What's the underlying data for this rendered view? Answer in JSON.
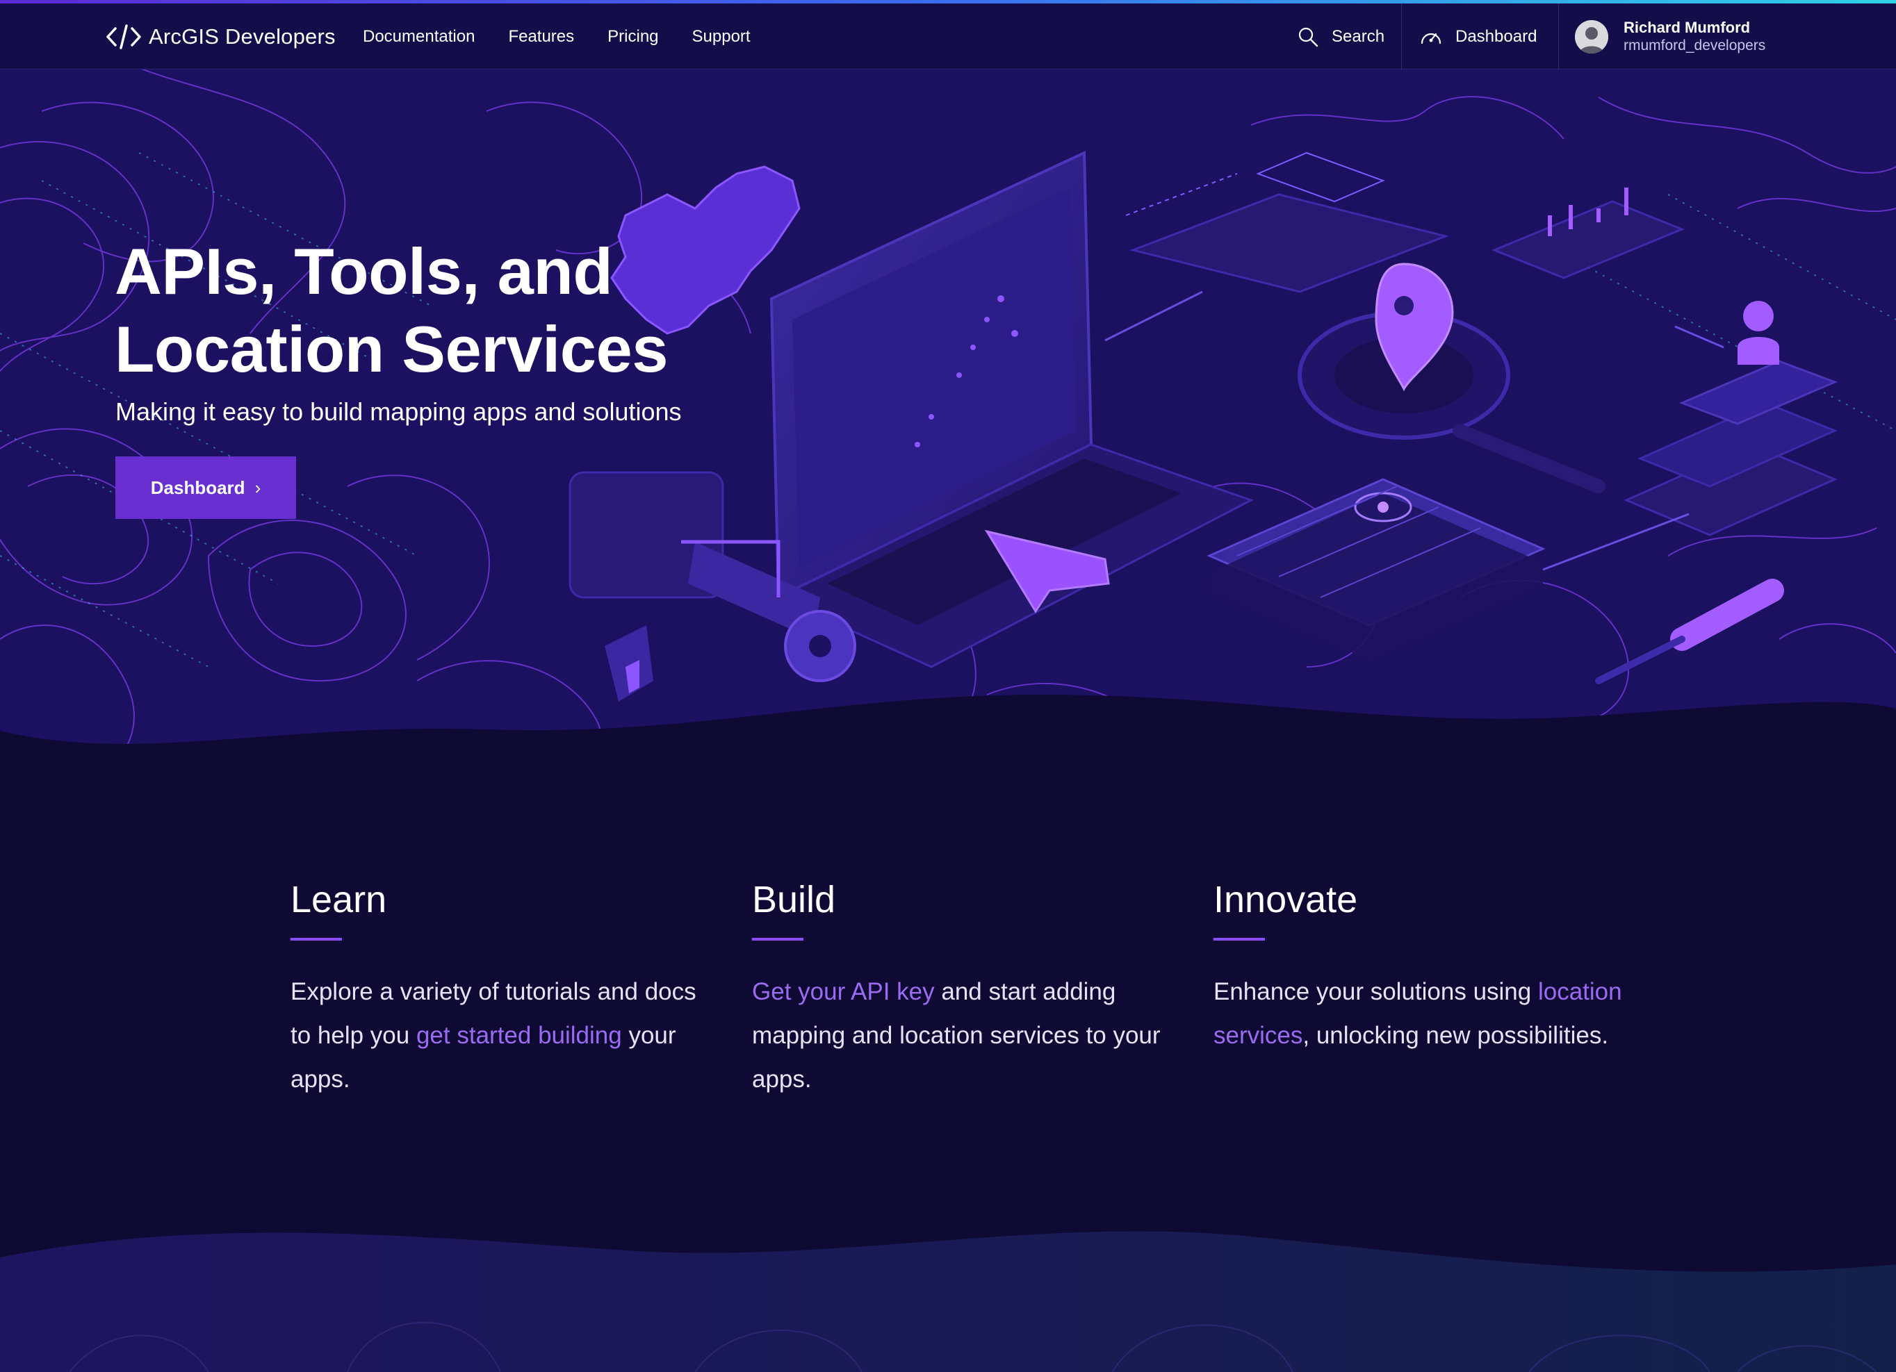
{
  "header": {
    "logo_text": "ArcGIS Developers",
    "nav": [
      "Documentation",
      "Features",
      "Pricing",
      "Support"
    ],
    "search_label": "Search",
    "dashboard_label": "Dashboard",
    "user": {
      "name": "Richard Mumford",
      "handle": "rmumford_developers"
    }
  },
  "hero": {
    "title_line1": "APIs, Tools, and",
    "title_line2": "Location Services",
    "subtitle": "Making it easy to build mapping apps and solutions",
    "cta_label": "Dashboard",
    "cta_chevron": "›"
  },
  "features": {
    "learn": {
      "title": "Learn",
      "text_before": "Explore a variety of tutorials and docs to help you ",
      "link": "get started building",
      "text_after": " your apps."
    },
    "build": {
      "title": "Build",
      "link": "Get your API key",
      "text_after": " and start adding mapping and location services to your apps."
    },
    "innovate": {
      "title": "Innovate",
      "text_before": "Enhance your solutions using ",
      "link": "location services",
      "text_after": ", unlocking new possibilities."
    }
  },
  "colors": {
    "header_bg": "#130d49",
    "hero_bg": "#1c1060",
    "page_bg": "#0e0a33",
    "accent_purple": "#6a2fd0",
    "link_purple": "#9b6bf0",
    "contour_line": "#7a3ee8"
  },
  "icons": {
    "logo": "code-brackets-icon",
    "search": "search-icon",
    "dashboard": "gauge-icon",
    "avatar": "user-avatar-icon",
    "cta": "chevron-right-icon"
  }
}
